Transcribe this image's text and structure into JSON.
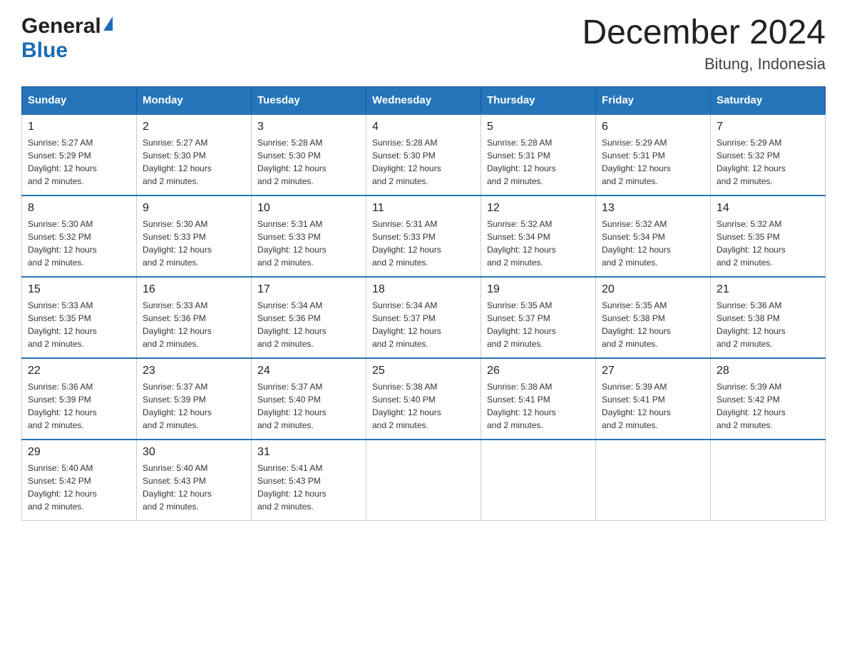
{
  "header": {
    "logo_general": "General",
    "logo_blue": "Blue",
    "month_title": "December 2024",
    "location": "Bitung, Indonesia"
  },
  "weekdays": [
    "Sunday",
    "Monday",
    "Tuesday",
    "Wednesday",
    "Thursday",
    "Friday",
    "Saturday"
  ],
  "weeks": [
    [
      {
        "day": "1",
        "sunrise": "5:27 AM",
        "sunset": "5:29 PM",
        "daylight": "12 hours and 2 minutes."
      },
      {
        "day": "2",
        "sunrise": "5:27 AM",
        "sunset": "5:30 PM",
        "daylight": "12 hours and 2 minutes."
      },
      {
        "day": "3",
        "sunrise": "5:28 AM",
        "sunset": "5:30 PM",
        "daylight": "12 hours and 2 minutes."
      },
      {
        "day": "4",
        "sunrise": "5:28 AM",
        "sunset": "5:30 PM",
        "daylight": "12 hours and 2 minutes."
      },
      {
        "day": "5",
        "sunrise": "5:28 AM",
        "sunset": "5:31 PM",
        "daylight": "12 hours and 2 minutes."
      },
      {
        "day": "6",
        "sunrise": "5:29 AM",
        "sunset": "5:31 PM",
        "daylight": "12 hours and 2 minutes."
      },
      {
        "day": "7",
        "sunrise": "5:29 AM",
        "sunset": "5:32 PM",
        "daylight": "12 hours and 2 minutes."
      }
    ],
    [
      {
        "day": "8",
        "sunrise": "5:30 AM",
        "sunset": "5:32 PM",
        "daylight": "12 hours and 2 minutes."
      },
      {
        "day": "9",
        "sunrise": "5:30 AM",
        "sunset": "5:33 PM",
        "daylight": "12 hours and 2 minutes."
      },
      {
        "day": "10",
        "sunrise": "5:31 AM",
        "sunset": "5:33 PM",
        "daylight": "12 hours and 2 minutes."
      },
      {
        "day": "11",
        "sunrise": "5:31 AM",
        "sunset": "5:33 PM",
        "daylight": "12 hours and 2 minutes."
      },
      {
        "day": "12",
        "sunrise": "5:32 AM",
        "sunset": "5:34 PM",
        "daylight": "12 hours and 2 minutes."
      },
      {
        "day": "13",
        "sunrise": "5:32 AM",
        "sunset": "5:34 PM",
        "daylight": "12 hours and 2 minutes."
      },
      {
        "day": "14",
        "sunrise": "5:32 AM",
        "sunset": "5:35 PM",
        "daylight": "12 hours and 2 minutes."
      }
    ],
    [
      {
        "day": "15",
        "sunrise": "5:33 AM",
        "sunset": "5:35 PM",
        "daylight": "12 hours and 2 minutes."
      },
      {
        "day": "16",
        "sunrise": "5:33 AM",
        "sunset": "5:36 PM",
        "daylight": "12 hours and 2 minutes."
      },
      {
        "day": "17",
        "sunrise": "5:34 AM",
        "sunset": "5:36 PM",
        "daylight": "12 hours and 2 minutes."
      },
      {
        "day": "18",
        "sunrise": "5:34 AM",
        "sunset": "5:37 PM",
        "daylight": "12 hours and 2 minutes."
      },
      {
        "day": "19",
        "sunrise": "5:35 AM",
        "sunset": "5:37 PM",
        "daylight": "12 hours and 2 minutes."
      },
      {
        "day": "20",
        "sunrise": "5:35 AM",
        "sunset": "5:38 PM",
        "daylight": "12 hours and 2 minutes."
      },
      {
        "day": "21",
        "sunrise": "5:36 AM",
        "sunset": "5:38 PM",
        "daylight": "12 hours and 2 minutes."
      }
    ],
    [
      {
        "day": "22",
        "sunrise": "5:36 AM",
        "sunset": "5:39 PM",
        "daylight": "12 hours and 2 minutes."
      },
      {
        "day": "23",
        "sunrise": "5:37 AM",
        "sunset": "5:39 PM",
        "daylight": "12 hours and 2 minutes."
      },
      {
        "day": "24",
        "sunrise": "5:37 AM",
        "sunset": "5:40 PM",
        "daylight": "12 hours and 2 minutes."
      },
      {
        "day": "25",
        "sunrise": "5:38 AM",
        "sunset": "5:40 PM",
        "daylight": "12 hours and 2 minutes."
      },
      {
        "day": "26",
        "sunrise": "5:38 AM",
        "sunset": "5:41 PM",
        "daylight": "12 hours and 2 minutes."
      },
      {
        "day": "27",
        "sunrise": "5:39 AM",
        "sunset": "5:41 PM",
        "daylight": "12 hours and 2 minutes."
      },
      {
        "day": "28",
        "sunrise": "5:39 AM",
        "sunset": "5:42 PM",
        "daylight": "12 hours and 2 minutes."
      }
    ],
    [
      {
        "day": "29",
        "sunrise": "5:40 AM",
        "sunset": "5:42 PM",
        "daylight": "12 hours and 2 minutes."
      },
      {
        "day": "30",
        "sunrise": "5:40 AM",
        "sunset": "5:43 PM",
        "daylight": "12 hours and 2 minutes."
      },
      {
        "day": "31",
        "sunrise": "5:41 AM",
        "sunset": "5:43 PM",
        "daylight": "12 hours and 2 minutes."
      },
      null,
      null,
      null,
      null
    ]
  ],
  "labels": {
    "sunrise": "Sunrise:",
    "sunset": "Sunset:",
    "daylight": "Daylight:"
  },
  "colors": {
    "header_bg": "#2575b8",
    "header_border": "#1a5a9a",
    "cell_border_top": "#2575b8",
    "cell_border": "#cccccc"
  }
}
